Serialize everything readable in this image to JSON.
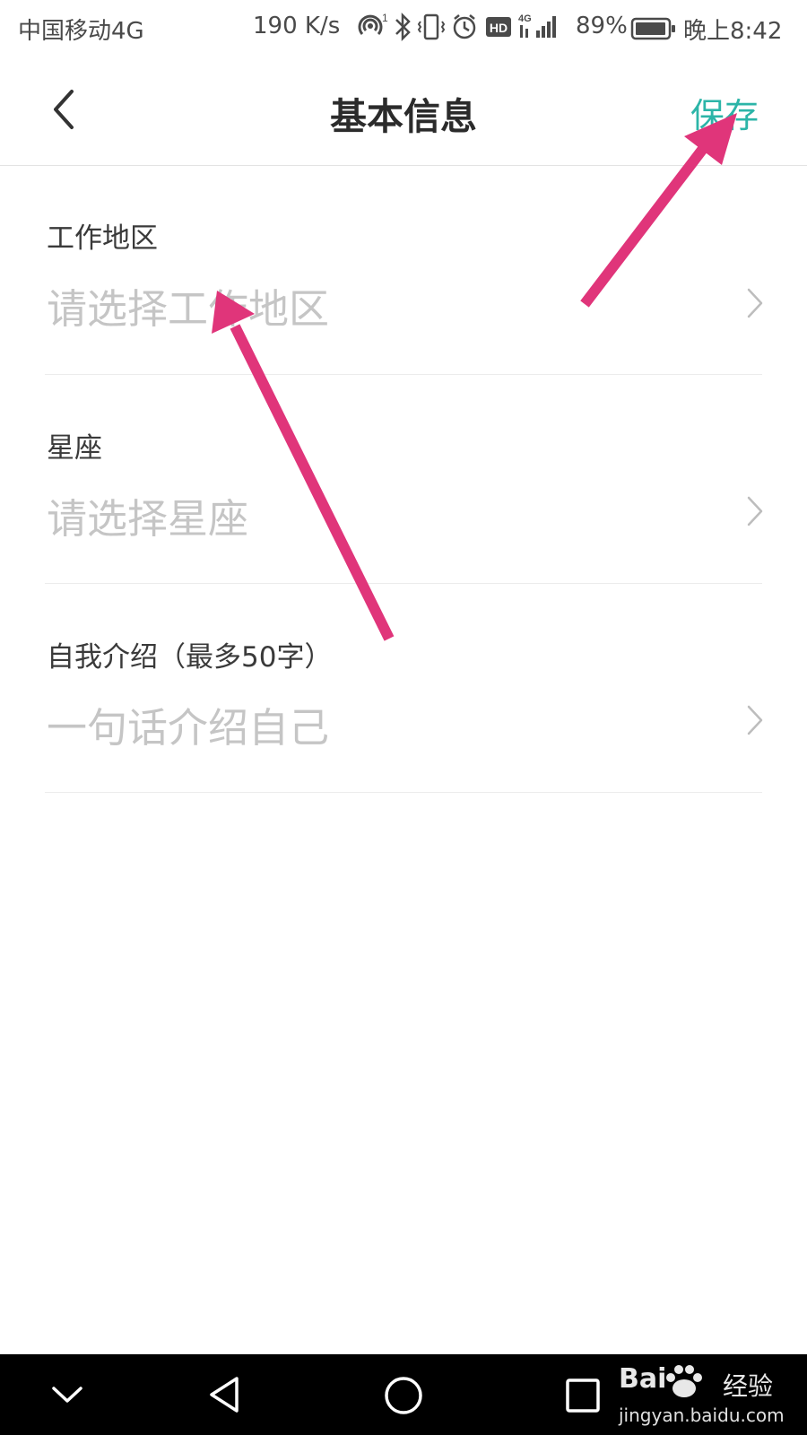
{
  "status_bar": {
    "carrier": "中国移动4G",
    "net_speed": "190 K/s",
    "battery": "89%",
    "time": "晚上8:42",
    "icons": [
      "hotspot-icon",
      "bluetooth-icon",
      "vibrate-icon",
      "alarm-icon",
      "hd-icon",
      "signal-4g-icon",
      "battery-icon"
    ]
  },
  "header": {
    "title": "基本信息",
    "save_label": "保存",
    "accent_color": "#2cb5a8"
  },
  "form": {
    "rows": [
      {
        "label": "工作地区",
        "placeholder": "请选择工作地区"
      },
      {
        "label": "星座",
        "placeholder": "请选择星座"
      },
      {
        "label": "自我介绍（最多50字）",
        "placeholder": "一句话介绍自己"
      }
    ]
  },
  "annotations": {
    "arrow_color": "#e0357a"
  },
  "nav_bar": {
    "buttons": [
      "collapse-icon",
      "back-triangle-icon",
      "home-circle-icon",
      "recents-square-icon"
    ]
  },
  "watermark": {
    "brand": "Bai",
    "brand_suffix": "经验",
    "url": "jingyan.baidu.com"
  }
}
